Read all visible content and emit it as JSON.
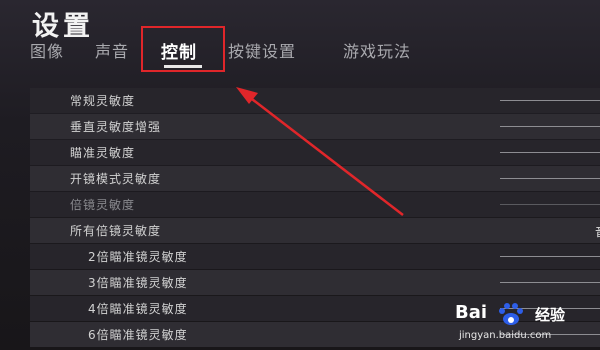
{
  "page": {
    "title": "设置"
  },
  "tabs": [
    {
      "label": "图像",
      "active": false
    },
    {
      "label": "声音",
      "active": false
    },
    {
      "label": "控制",
      "active": true
    },
    {
      "label": "按键设置",
      "active": false
    },
    {
      "label": "游戏玩法",
      "active": false
    }
  ],
  "settings": [
    {
      "label": "常规灵敏度"
    },
    {
      "label": "垂直灵敏度增强"
    },
    {
      "label": "瞄准灵敏度"
    },
    {
      "label": "开镜模式灵敏度"
    },
    {
      "label": "倍镜灵敏度"
    },
    {
      "label": "所有倍镜灵敏度"
    },
    {
      "label": "2倍瞄准镜灵敏度"
    },
    {
      "label": "3倍瞄准镜灵敏度"
    },
    {
      "label": "4倍瞄准镜灵敏度"
    },
    {
      "label": "6倍瞄准镜灵敏度"
    }
  ],
  "edge_glyph": "音",
  "annotation": {
    "highlight_color": "#e0262a"
  },
  "watermark": {
    "logo_text": "Bai",
    "logo_suffix": "经验",
    "url": "jingyan.baidu.com"
  }
}
